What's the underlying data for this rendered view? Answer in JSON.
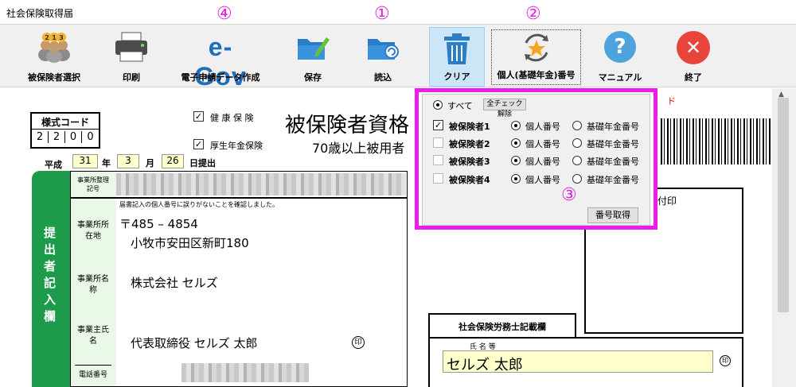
{
  "window": {
    "title": "社会保険取得届"
  },
  "toolbar": {
    "buttons": [
      {
        "label": "被保険者選択",
        "icon": "people-ranking-icon"
      },
      {
        "label": "印刷",
        "icon": "printer-icon"
      },
      {
        "label": "電子申請データ作成",
        "icon": "egov-logo",
        "logo_text": "e-Gov"
      },
      {
        "label": "保存",
        "icon": "folder-save-icon"
      },
      {
        "label": "読込",
        "icon": "folder-load-icon"
      },
      {
        "label": "クリア",
        "icon": "trash-icon"
      },
      {
        "label": "個人(基礎年金)番号",
        "icon": "star-refresh-icon"
      },
      {
        "label": "マニュアル",
        "icon": "help-icon",
        "glyph": "?"
      },
      {
        "label": "終了",
        "icon": "close-icon",
        "glyph": "✕"
      }
    ]
  },
  "annotations": {
    "a1": "①",
    "a2": "②",
    "a3": "③",
    "a4": "④"
  },
  "form": {
    "style_code_label": "様式コード",
    "style_code_digits": [
      "2",
      "2",
      "0",
      "0"
    ],
    "health_insurance": "健 康 保 険",
    "pension_insurance": "厚生年金保険",
    "title": "被保険者資格",
    "subtitle": "70歳以上被用者",
    "date": {
      "era": "平成",
      "year": "31",
      "year_unit": "年",
      "month": "3",
      "month_unit": "月",
      "day": "26",
      "day_suffix": "日提出"
    },
    "submitter_label": "提出者記入欄",
    "office_code_label": "事業所整理記号",
    "confirm_text": "届書記入の個人番号に誤りがないことを確認しました。",
    "address_label": "事業所所在地",
    "postal": "〒485 – 4854",
    "address": "小牧市安田区新町180",
    "office_name_label": "事業所名称",
    "office_name": "株式会社 セルズ",
    "owner_label": "事業主氏名",
    "owner": "代表取締役 セルズ 太郎",
    "seal": "印",
    "phone_label": "電話番号",
    "receipt_label": "付印",
    "labor_consultant_label": "社会保険労務士記載欄",
    "name_etc_label": "氏 名 等",
    "consultant_name": "セルズ 太郎",
    "red_char": "ド"
  },
  "popup": {
    "all_label": "すべて",
    "uncheck_all_button": "全チェック解除",
    "rows": [
      {
        "label": "被保険者1",
        "checked": true,
        "opt1": "個人番号",
        "opt2": "基礎年金番号"
      },
      {
        "label": "被保険者2",
        "checked": false,
        "opt1": "個人番号",
        "opt2": "基礎年金番号"
      },
      {
        "label": "被保険者3",
        "checked": false,
        "opt1": "個人番号",
        "opt2": "基礎年金番号"
      },
      {
        "label": "被保険者4",
        "checked": false,
        "opt1": "個人番号",
        "opt2": "基礎年金番号"
      }
    ],
    "get_number_button": "番号取得"
  },
  "colors": {
    "highlight": "#ef1be8",
    "green": "#1d9a4a",
    "active_button": "#cde6f7"
  }
}
